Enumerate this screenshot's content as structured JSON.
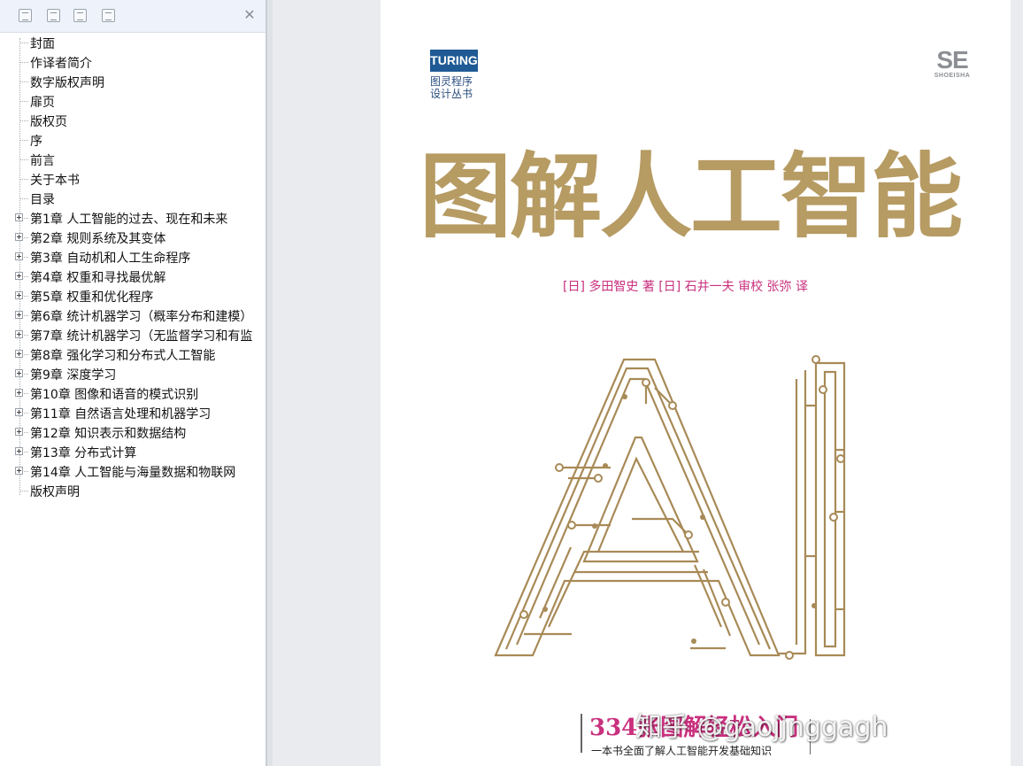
{
  "bookmarks_panel": {
    "close_glyph": "✕",
    "toolbar_icons": [
      "expand-all-icon",
      "collapse-all-icon",
      "add-bookmark-icon",
      "delete-bookmark-icon"
    ],
    "items": [
      {
        "label": "封面",
        "expandable": false
      },
      {
        "label": "作译者简介",
        "expandable": false
      },
      {
        "label": "数字版权声明",
        "expandable": false
      },
      {
        "label": "扉页",
        "expandable": false
      },
      {
        "label": "版权页",
        "expandable": false
      },
      {
        "label": "序",
        "expandable": false
      },
      {
        "label": "前言",
        "expandable": false
      },
      {
        "label": "关于本书",
        "expandable": false
      },
      {
        "label": "目录",
        "expandable": false
      },
      {
        "label": "第1章 人工智能的过去、现在和未来",
        "expandable": true
      },
      {
        "label": "第2章 规则系统及其变体",
        "expandable": true
      },
      {
        "label": "第3章 自动机和人工生命程序",
        "expandable": true
      },
      {
        "label": "第4章 权重和寻找最优解",
        "expandable": true
      },
      {
        "label": "第5章 权重和优化程序",
        "expandable": true
      },
      {
        "label": "第6章 统计机器学习（概率分布和建模）",
        "expandable": true
      },
      {
        "label": "第7章 统计机器学习（无监督学习和有监",
        "expandable": true
      },
      {
        "label": "第8章 强化学习和分布式人工智能",
        "expandable": true
      },
      {
        "label": "第9章 深度学习",
        "expandable": true
      },
      {
        "label": "第10章 图像和语音的模式识别",
        "expandable": true
      },
      {
        "label": "第11章 自然语言处理和机器学习",
        "expandable": true
      },
      {
        "label": "第12章 知识表示和数据结构",
        "expandable": true
      },
      {
        "label": "第13章 分布式计算",
        "expandable": true
      },
      {
        "label": "第14章 人工智能与海量数据和物联网",
        "expandable": true
      },
      {
        "label": "版权声明",
        "expandable": false
      }
    ]
  },
  "cover": {
    "publisher_logo": "TURING",
    "series_line1": "图灵程序",
    "series_line2": "设计丛书",
    "se_logo": "SE",
    "se_logo_sub": "SHOEISHA",
    "title": "图解人工智能",
    "authors": "[日] 多田智史 著    [日] 石井一夫 审校    张弥 译",
    "art_text": "AI",
    "tagline": "334张图解轻松入门",
    "tagline_sub": "一本书全面了解人工智能开发基础知识",
    "colors": {
      "title": "#b69b63",
      "accent": "#c9307e",
      "circuit": "#a88a57",
      "logo": "#1f5a94"
    }
  },
  "watermark": "知乎 @gaojjnggagh"
}
